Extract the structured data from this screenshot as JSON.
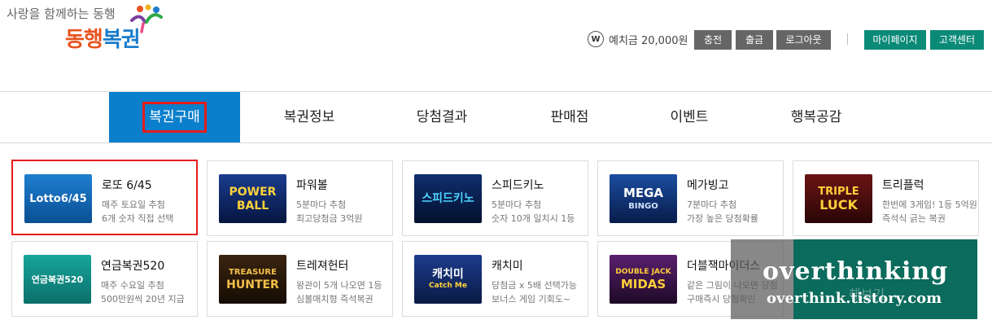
{
  "header": {
    "tagline": "사랑을 함께하는 동행",
    "brand_a": "동행",
    "brand_b": "복권",
    "wallet_icon": "W",
    "balance": "예치금 20,000원",
    "buttons": {
      "deposit": "충전",
      "withdraw": "출금",
      "logout": "로그아웃",
      "mypage": "마이페이지",
      "support": "고객센터"
    }
  },
  "nav": [
    "복권구매",
    "복권정보",
    "당첨결과",
    "판매점",
    "이벤트",
    "행복공감"
  ],
  "games": [
    {
      "title": "로또 6/45",
      "line1": "매주 토요일 추첨",
      "line2": "6개 숫자 직접 선택",
      "thumb": "Lotto6/45"
    },
    {
      "title": "파워볼",
      "line1": "5분마다 추첨",
      "line2": "최고당첨금 3억원",
      "thumb_a": "POWER",
      "thumb_b": "BALL"
    },
    {
      "title": "스피드키노",
      "line1": "5분마다 추첨",
      "line2": "숫자 10개 일치시 1등",
      "thumb": "스피드키노"
    },
    {
      "title": "메가빙고",
      "line1": "7분마다 추첨",
      "line2": "가장 높은 당첨확률",
      "thumb_a": "MEGA",
      "thumb_b": "BINGO"
    },
    {
      "title": "트리플럭",
      "line1": "한번에 3게임! 1등 5억원",
      "line2": "즉석식 긁는 복권",
      "thumb_a": "TRIPLE",
      "thumb_b": "LUCK"
    },
    {
      "title": "연금복권520",
      "line1": "매주 수요일 추첨",
      "line2": "500만원씩 20년 지급",
      "thumb": "연금복권520"
    },
    {
      "title": "트레져헌터",
      "line1": "왕관이 5개 나오면 1등",
      "line2": "심볼매치형 즉석복권",
      "thumb_a": "TREASURE",
      "thumb_b": "HUNTER"
    },
    {
      "title": "캐치미",
      "line1": "당첨금 x 5배 선택가능",
      "line2": "보너스 게임 기회도~",
      "thumb_a": "캐치미",
      "thumb_b": "Catch Me"
    },
    {
      "title": "더블잭마이더스",
      "line1": "같은 그림이 나오면 당첨",
      "line2": "구매즉시 당첨확인",
      "thumb_a": "DOUBLE JACK",
      "thumb_b": "MIDAS"
    }
  ],
  "watermark": {
    "big": "overthinking",
    "small": "overthink.tistory.com",
    "peek": "해보기"
  }
}
